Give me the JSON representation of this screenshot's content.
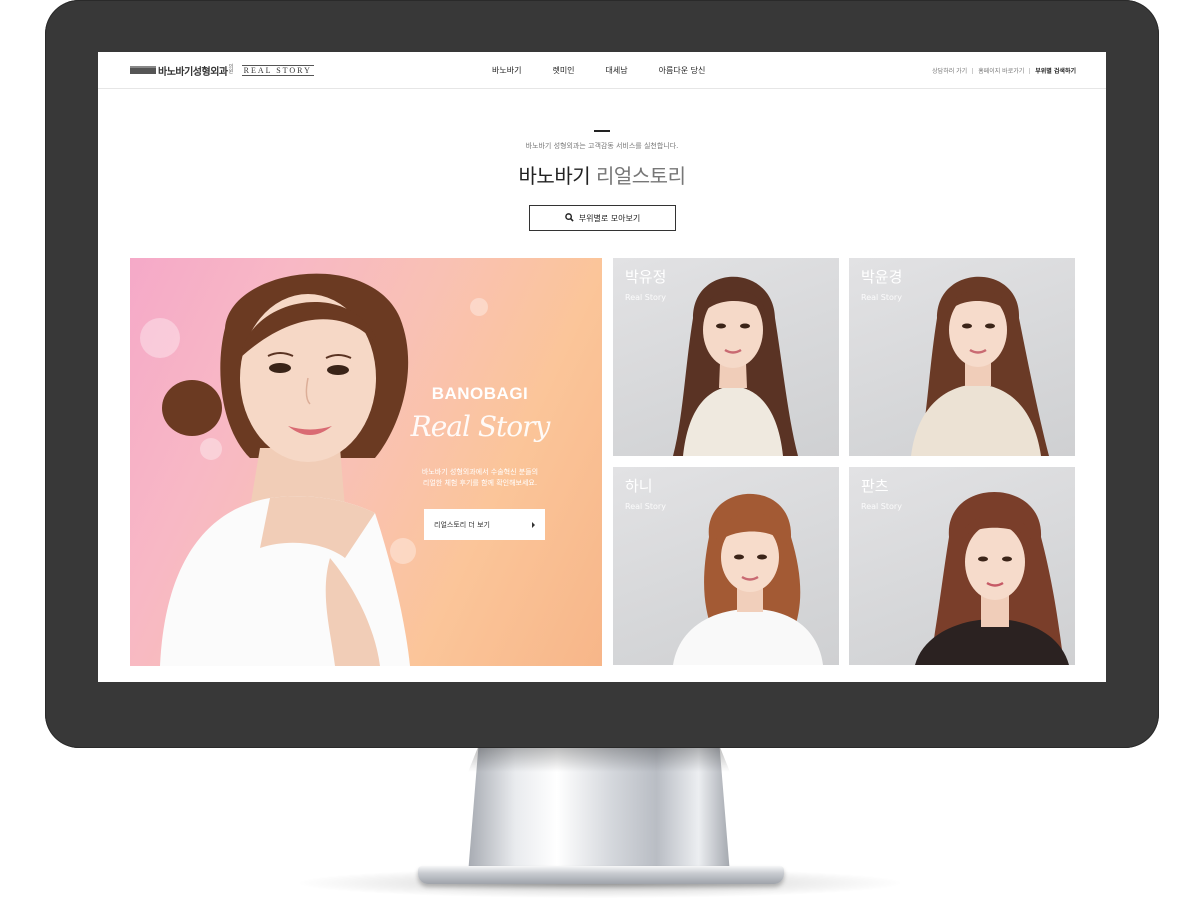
{
  "header": {
    "logo_text": "바노바기성형외과",
    "logo_sub": "의원",
    "logo_realstory": "REAL STORY",
    "nav": [
      "바노바기",
      "렛미인",
      "대세남",
      "아름다운 당신"
    ],
    "util": [
      "상담하러 가기",
      "홈페이지 바로가기",
      "부위별 검색하기"
    ]
  },
  "intro": {
    "subtitle": "바노바기 성형외과는 고객감동 서비스를 실천합니다.",
    "title_bold": "바노바기",
    "title_light": "리얼스토리",
    "collect_button": "부위별로 모아보기"
  },
  "hero": {
    "brand": "BANOBAGI",
    "script": "Real Story",
    "desc_line1": "바노바기 성형외과에서 수술혁신 분들의",
    "desc_line2": "리얼한 체험 후기를 함께 확인해보세요.",
    "button": "리얼스토리 더 보기"
  },
  "cards": [
    {
      "name": "박유정",
      "tag": "Real Story"
    },
    {
      "name": "박윤경",
      "tag": "Real Story"
    },
    {
      "name": "하니",
      "tag": "Real Story"
    },
    {
      "name": "판츠",
      "tag": "Real Story"
    }
  ],
  "icons": {
    "search": "search-icon",
    "arrow": "arrow-right-icon"
  },
  "colors": {
    "bezel": "#383838",
    "card_bg": "#d6d7d9",
    "hero_pink": "#f5a9c8",
    "hero_orange": "#fbc599"
  }
}
